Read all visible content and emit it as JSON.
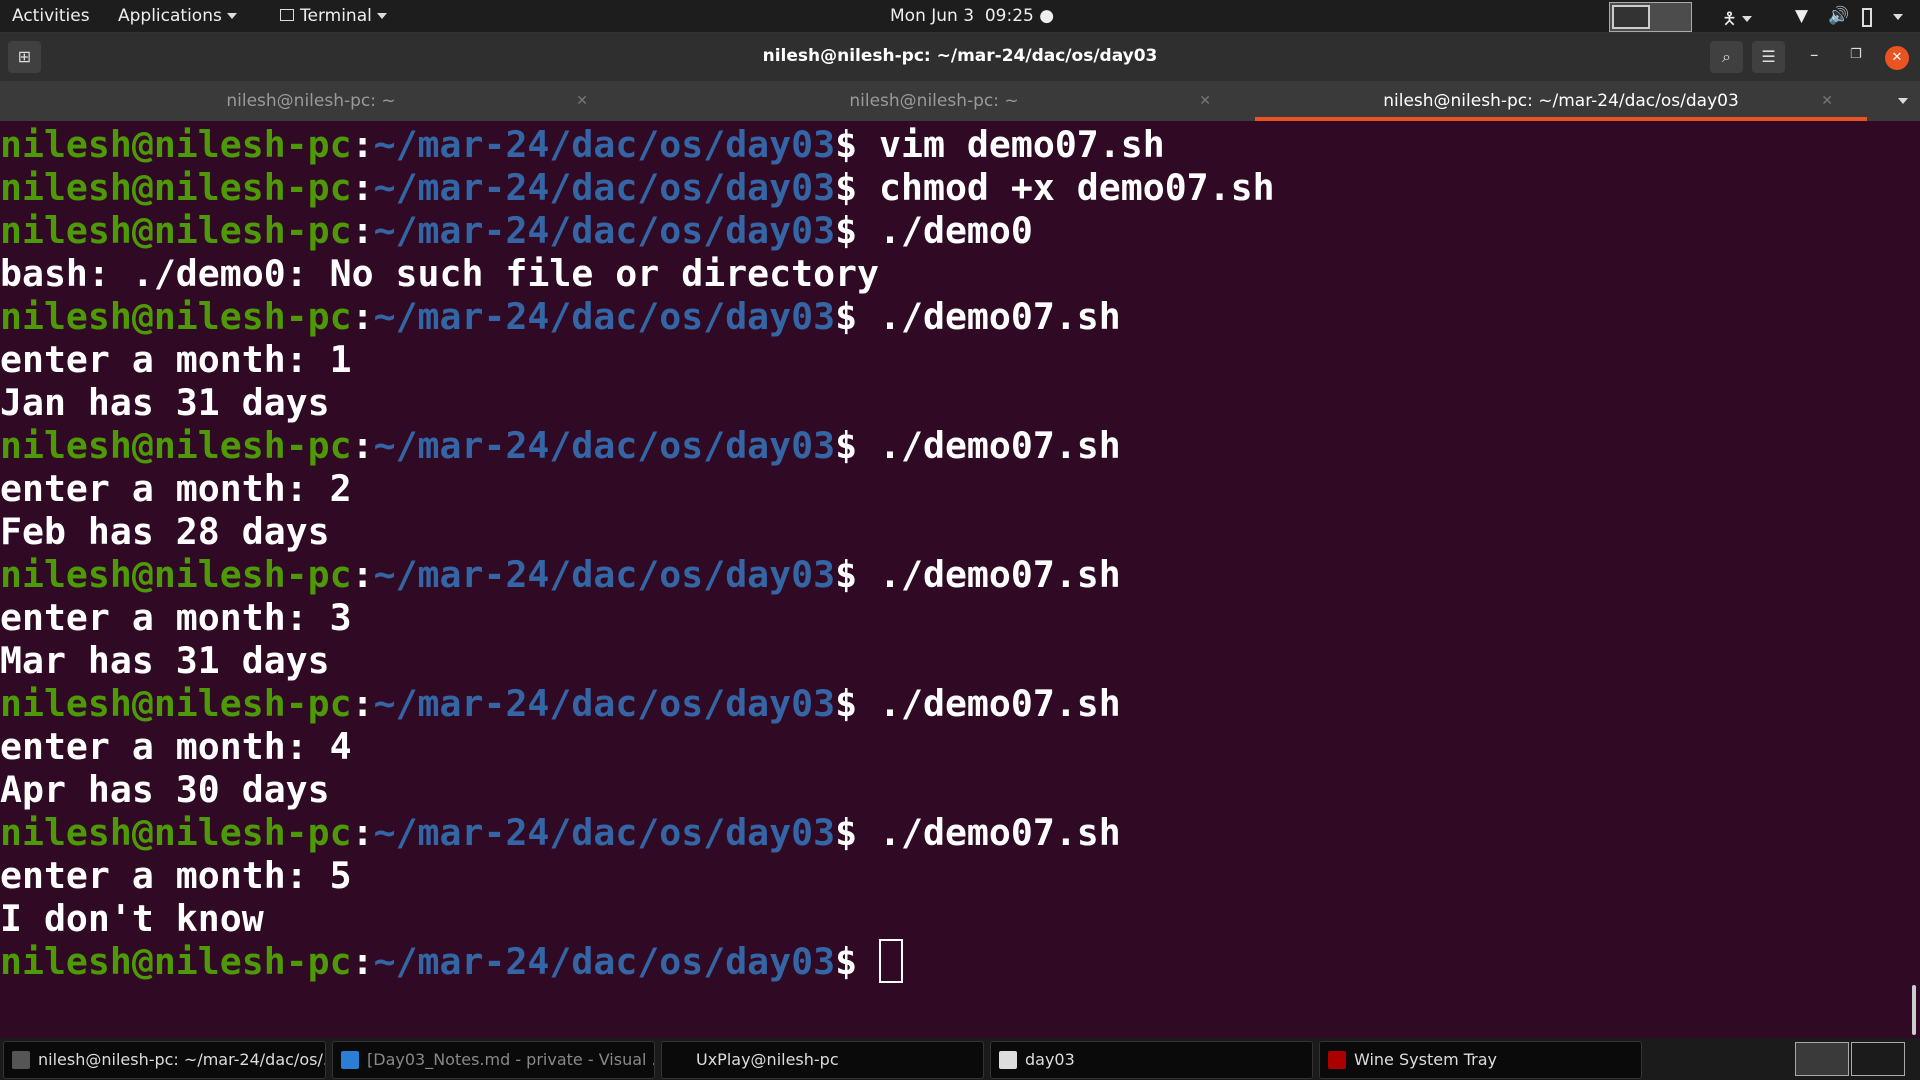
{
  "topbar": {
    "activities": "Activities",
    "applications": "Applications",
    "terminal": "Terminal",
    "clock": "Mon Jun 3  09:25"
  },
  "window": {
    "title": "nilesh@nilesh-pc: ~/mar-24/dac/os/day03"
  },
  "tabs": [
    {
      "label": "nilesh@nilesh-pc: ~"
    },
    {
      "label": "nilesh@nilesh-pc: ~"
    },
    {
      "label": "nilesh@nilesh-pc: ~/mar-24/dac/os/day03"
    }
  ],
  "prompt": {
    "user": "nilesh@nilesh-pc",
    "colon": ":",
    "path": "~/mar-24/dac/os/day03",
    "dollar": "$ "
  },
  "lines": [
    {
      "type": "cmd",
      "text": "vim demo07.sh"
    },
    {
      "type": "cmd",
      "text": "chmod +x demo07.sh"
    },
    {
      "type": "cmd",
      "text": "./demo0"
    },
    {
      "type": "out",
      "text": "bash: ./demo0: No such file or directory"
    },
    {
      "type": "cmd",
      "text": "./demo07.sh"
    },
    {
      "type": "out",
      "text": "enter a month: 1"
    },
    {
      "type": "out",
      "text": "Jan has 31 days"
    },
    {
      "type": "cmd",
      "text": "./demo07.sh"
    },
    {
      "type": "out",
      "text": "enter a month: 2"
    },
    {
      "type": "out",
      "text": "Feb has 28 days"
    },
    {
      "type": "cmd",
      "text": "./demo07.sh"
    },
    {
      "type": "out",
      "text": "enter a month: 3"
    },
    {
      "type": "out",
      "text": "Mar has 31 days"
    },
    {
      "type": "cmd",
      "text": "./demo07.sh"
    },
    {
      "type": "out",
      "text": "enter a month: 4"
    },
    {
      "type": "out",
      "text": "Apr has 30 days"
    },
    {
      "type": "cmd",
      "text": "./demo07.sh"
    },
    {
      "type": "out",
      "text": "enter a month: 5"
    },
    {
      "type": "out",
      "text": "I don't know"
    },
    {
      "type": "cmd",
      "text": ""
    }
  ],
  "taskbar": [
    {
      "label": "nilesh@nilesh-pc: ~/mar-24/dac/os/...",
      "icon": "terminal-icon"
    },
    {
      "label": "[Day03_Notes.md - private - Visual ...",
      "icon": "vscode-icon"
    },
    {
      "label": "UxPlay@nilesh-pc",
      "icon": ""
    },
    {
      "label": "day03",
      "icon": "folder-icon"
    },
    {
      "label": "Wine System Tray",
      "icon": "wine-icon"
    }
  ],
  "colors": {
    "bg": "#300a24",
    "user": "#4e9a06",
    "path": "#3465a4",
    "accent": "#e95420"
  }
}
